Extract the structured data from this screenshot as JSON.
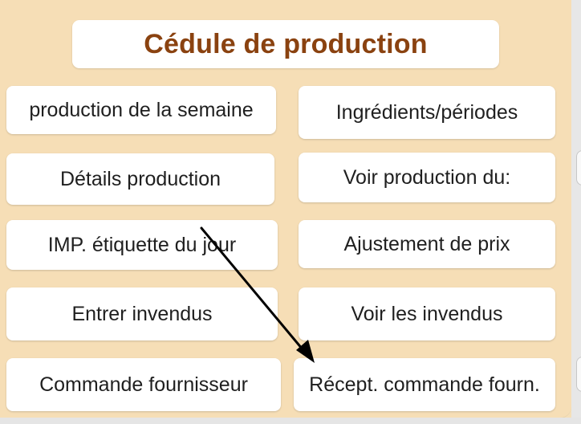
{
  "window": {
    "title": "Cédule de production"
  },
  "buttons": {
    "week_production": "production de la semaine",
    "ingredients_periods": "Ingrédients/périodes",
    "production_details": "Détails production",
    "see_production_of": "Voir production du:",
    "print_day_label": "IMP. étiquette du jour",
    "price_adjustment": "Ajustement de prix",
    "enter_unsold": "Entrer invendus",
    "see_unsold": "Voir les invendus",
    "supplier_order": "Commande fournisseur",
    "receive_supplier_order": "Récept. commande fourn."
  },
  "colors": {
    "panel_background": "#f6deb6",
    "title_color": "#8a4210",
    "button_background": "#ffffff",
    "arrow_color": "#000000"
  }
}
